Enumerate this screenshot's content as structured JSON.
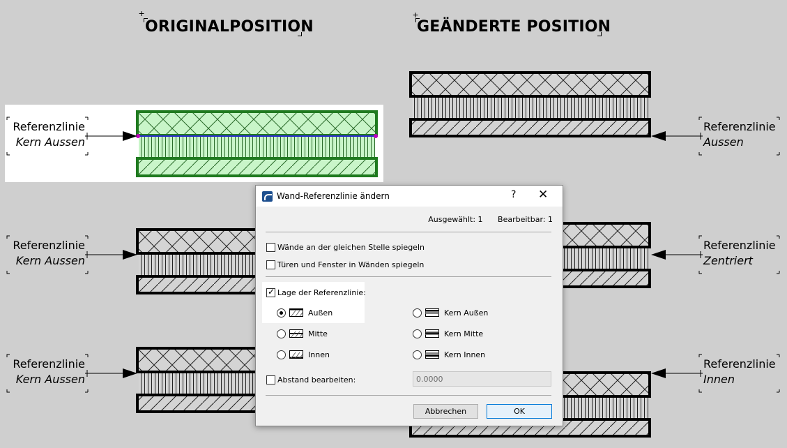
{
  "headings": {
    "original": "ORIGINALPOSITION",
    "changed": "GEÄNDERTE POSITION"
  },
  "left_labels": [
    {
      "line1": "Referenzlinie",
      "line2": "Kern Aussen"
    },
    {
      "line1": "Referenzlinie",
      "line2": "Kern Aussen"
    },
    {
      "line1": "Referenzlinie",
      "line2": "Kern Aussen"
    }
  ],
  "right_labels": [
    {
      "line1": "Referenzlinie",
      "line2": "Aussen"
    },
    {
      "line1": "Referenzlinie",
      "line2": "Zentriert"
    },
    {
      "line1": "Referenzlinie",
      "line2": "Innen"
    }
  ],
  "colors": {
    "background": "#cfcfcf",
    "selected_wall_fill": "#c9f5c9",
    "selected_wall_stroke": "#1f7a1f",
    "reference_line": "#2a2ad0",
    "accent": "#0078d7"
  },
  "dialog": {
    "title": "Wand-Referenzlinie ändern",
    "help_label": "?",
    "close_label": "✕",
    "selected_count": "Ausgewählt: 1",
    "editable_count": "Bearbeitbar: 1",
    "mirror_walls": "Wände an der gleichen Stelle spiegeln",
    "mirror_doors": "Türen und Fenster in Wänden spiegeln",
    "reference_position": "Lage der Referenzlinie:",
    "options": {
      "outside": "Außen",
      "center": "Mitte",
      "inside": "Innen",
      "core_outside": "Kern Außen",
      "core_center": "Kern Mitte",
      "core_inside": "Kern Innen"
    },
    "edit_offset": "Abstand bearbeiten:",
    "offset_value": "0.0000",
    "cancel": "Abbrechen",
    "ok": "OK"
  }
}
